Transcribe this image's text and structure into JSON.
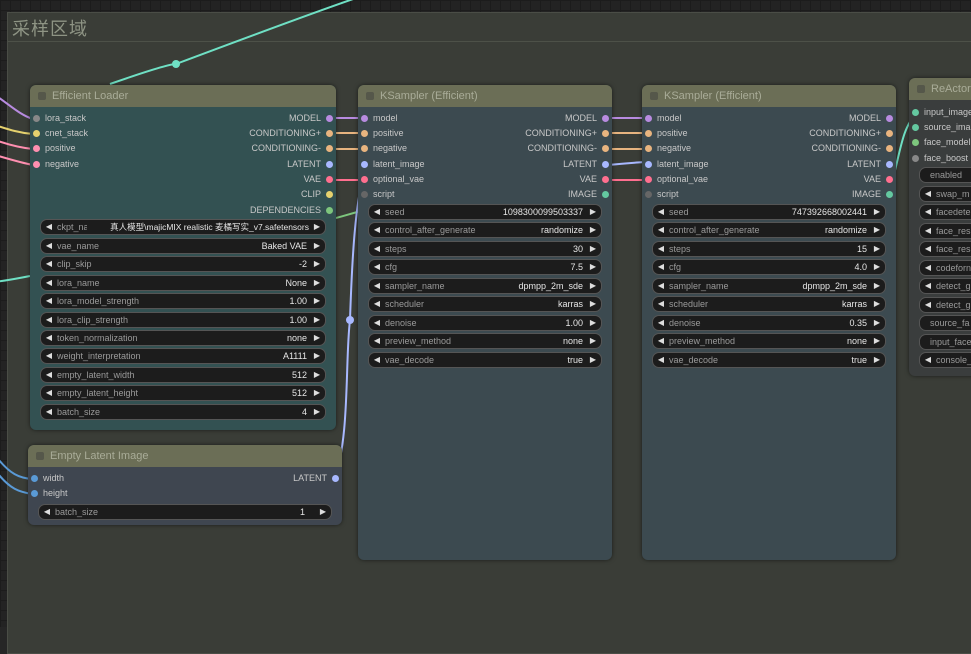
{
  "group": {
    "title": "采样区域"
  },
  "colors": {
    "model": "#b88be0",
    "conditioning": "#e8b47f",
    "latent": "#a8b8ff",
    "vae": "#ff6f8f",
    "clip": "#e5d16e",
    "dependencies": "#7dc67d",
    "script": "#888888",
    "image": "#64c8a0",
    "int": "#5a9ad6",
    "wire_teal": "#6fe0c4"
  },
  "nodes": {
    "efficient_loader": {
      "title": "Efficient Loader",
      "inputs": [
        "lora_stack",
        "cnet_stack",
        "positive",
        "negative"
      ],
      "outputs": [
        "MODEL",
        "CONDITIONING+",
        "CONDITIONING-",
        "LATENT",
        "VAE",
        "CLIP",
        "DEPENDENCIES"
      ],
      "widgets": [
        {
          "label": "ckpt_name",
          "value": "真人模型\\majicMIX realistic 麦橘写实_v7.safetensors"
        },
        {
          "label": "vae_name",
          "value": "Baked VAE"
        },
        {
          "label": "clip_skip",
          "value": "-2"
        },
        {
          "label": "lora_name",
          "value": "None"
        },
        {
          "label": "lora_model_strength",
          "value": "1.00"
        },
        {
          "label": "lora_clip_strength",
          "value": "1.00"
        },
        {
          "label": "token_normalization",
          "value": "none"
        },
        {
          "label": "weight_interpretation",
          "value": "A1111"
        },
        {
          "label": "empty_latent_width",
          "value": "512"
        },
        {
          "label": "empty_latent_height",
          "value": "512"
        },
        {
          "label": "batch_size",
          "value": "4"
        }
      ]
    },
    "empty_latent": {
      "title": "Empty Latent Image",
      "inputs": [
        "width",
        "height"
      ],
      "outputs": [
        "LATENT"
      ],
      "widgets": [
        {
          "label": "batch_size",
          "value": "1"
        }
      ]
    },
    "ksampler1": {
      "title": "KSampler (Efficient)",
      "inputs": [
        "model",
        "positive",
        "negative",
        "latent_image",
        "optional_vae",
        "script"
      ],
      "outputs": [
        "MODEL",
        "CONDITIONING+",
        "CONDITIONING-",
        "LATENT",
        "VAE",
        "IMAGE"
      ],
      "widgets": [
        {
          "label": "seed",
          "value": "1098300099503337"
        },
        {
          "label": "control_after_generate",
          "value": "randomize"
        },
        {
          "label": "steps",
          "value": "30"
        },
        {
          "label": "cfg",
          "value": "7.5"
        },
        {
          "label": "sampler_name",
          "value": "dpmpp_2m_sde"
        },
        {
          "label": "scheduler",
          "value": "karras"
        },
        {
          "label": "denoise",
          "value": "1.00"
        },
        {
          "label": "preview_method",
          "value": "none"
        },
        {
          "label": "vae_decode",
          "value": "true"
        }
      ]
    },
    "ksampler2": {
      "title": "KSampler (Efficient)",
      "inputs": [
        "model",
        "positive",
        "negative",
        "latent_image",
        "optional_vae",
        "script"
      ],
      "outputs": [
        "MODEL",
        "CONDITIONING+",
        "CONDITIONING-",
        "LATENT",
        "VAE",
        "IMAGE"
      ],
      "widgets": [
        {
          "label": "seed",
          "value": "747392668002441"
        },
        {
          "label": "control_after_generate",
          "value": "randomize"
        },
        {
          "label": "steps",
          "value": "15"
        },
        {
          "label": "cfg",
          "value": "4.0"
        },
        {
          "label": "sampler_name",
          "value": "dpmpp_2m_sde"
        },
        {
          "label": "scheduler",
          "value": "karras"
        },
        {
          "label": "denoise",
          "value": "0.35"
        },
        {
          "label": "preview_method",
          "value": "none"
        },
        {
          "label": "vae_decode",
          "value": "true"
        }
      ]
    },
    "reactor": {
      "title": "ReActor",
      "inputs": [
        "input_image",
        "source_ima",
        "face_model",
        "face_boost"
      ],
      "widgets": [
        {
          "label": "enabled",
          "plain": true
        },
        {
          "label": "swap_m"
        },
        {
          "label": "facedete"
        },
        {
          "label": "face_res"
        },
        {
          "label": "face_res"
        },
        {
          "label": "codeforn"
        },
        {
          "label": "detect_g"
        },
        {
          "label": "detect_g"
        },
        {
          "label": "source_fa",
          "plain": true
        },
        {
          "label": "input_face",
          "plain": true
        },
        {
          "label": "console_"
        }
      ]
    }
  }
}
